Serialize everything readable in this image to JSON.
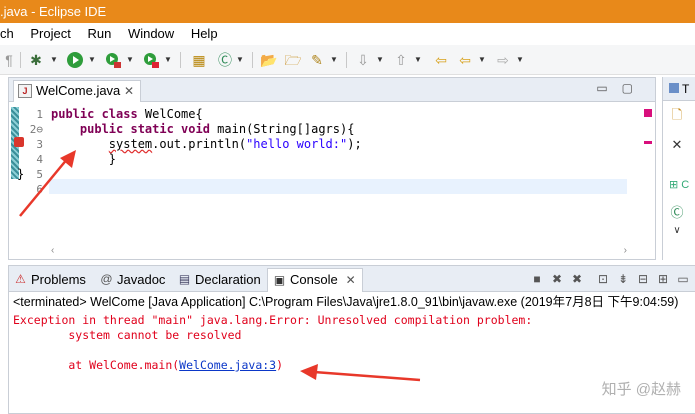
{
  "window": {
    "title": ".java - Eclipse IDE"
  },
  "menubar": {
    "items": [
      "ch",
      "Project",
      "Run",
      "Window",
      "Help"
    ]
  },
  "editor": {
    "tab_label": "WelCome.java",
    "line_numbers": [
      "1",
      "2⊖",
      "3",
      "4",
      "5",
      "6"
    ],
    "lines": {
      "l1_kw": "public class",
      "l1_rest": " WelCome{",
      "l2_kw": "    public static void",
      "l2_rest": " main(String[]agrs){",
      "l3_pre": "        ",
      "l3_err": "system",
      "l3_mid": ".out.println(",
      "l3_str": "\"hello world:\"",
      "l3_end": ");",
      "l4": "        }",
      "l5": "}"
    }
  },
  "right_panel": {
    "tab_label": "T",
    "icon_label": "C"
  },
  "bottom_panel": {
    "tabs": [
      "Problems",
      "Javadoc",
      "Declaration",
      "Console"
    ],
    "active_tab": "Console",
    "console_header": "<terminated> WelCome [Java Application] C:\\Program Files\\Java\\jre1.8.0_91\\bin\\javaw.exe (2019年7月8日 下午9:04:59)",
    "output": {
      "line1": "Exception in thread \"main\" java.lang.Error: Unresolved compilation problem: ",
      "line2": "        system cannot be resolved",
      "line3_pre": "        at WelCome.main(",
      "line3_link": "WelCome.java:3",
      "line3_post": ")"
    }
  },
  "watermark": "知乎 @赵赫",
  "colors": {
    "titlebar": "#e8891a",
    "keyword": "#7f0055",
    "string": "#2a00ff",
    "console_error": "#e0001b",
    "annotation_arrow": "#e8382a"
  }
}
